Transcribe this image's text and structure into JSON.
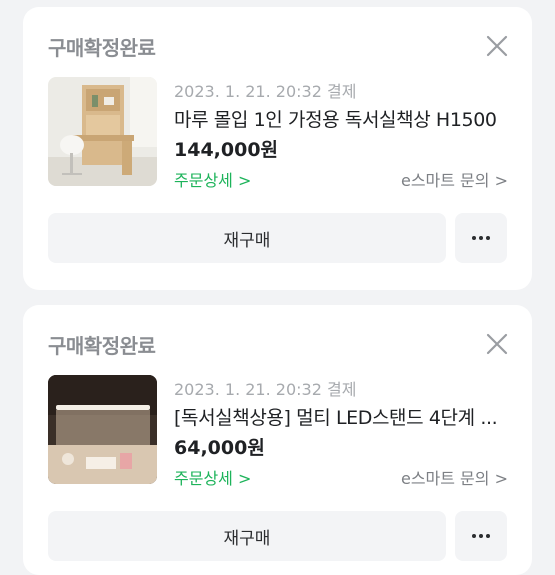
{
  "orders": [
    {
      "status": "구매확정완료",
      "date": "2023. 1. 21. 20:32 결제",
      "title": "마루 몰입 1인 가정용 독서실책상 H1500",
      "price": "144,000원",
      "detail_link": "주문상세 >",
      "inquiry_link": "e스마트 문의 >",
      "rebuy_label": "재구매",
      "more_label": "•••"
    },
    {
      "status": "구매확정완료",
      "date": "2023. 1. 21. 20:32 결제",
      "title": "[독서실책상용] 멀티 LED스탠드 4단계 ...",
      "price": "64,000원",
      "detail_link": "주문상세 >",
      "inquiry_link": "e스마트 문의 >",
      "rebuy_label": "재구매",
      "more_label": "•••"
    }
  ],
  "colors": {
    "background": "#f2f3f5",
    "card": "#ffffff",
    "accent_green": "#1db35a",
    "status_gray": "#8a8d92"
  },
  "icons": [
    "close-icon",
    "more-icon",
    "chevron-right-icon"
  ]
}
